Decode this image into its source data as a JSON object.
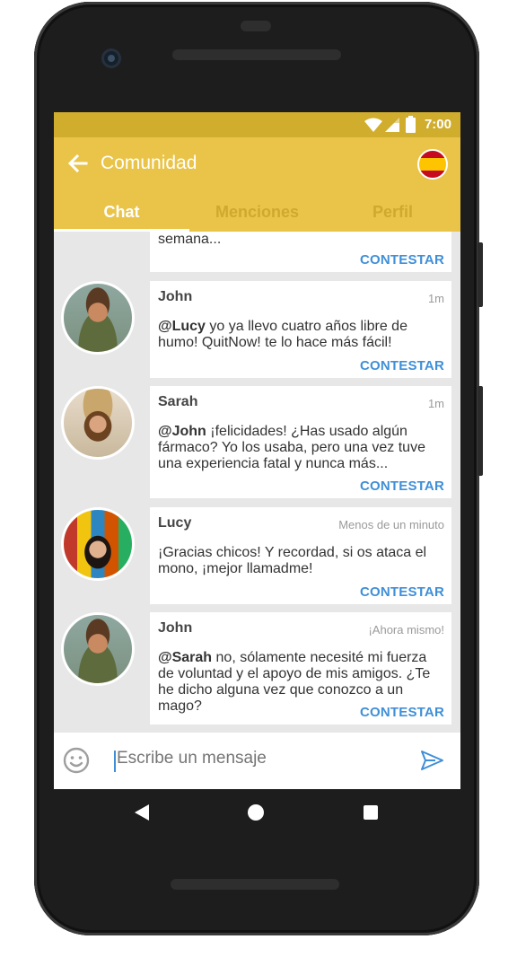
{
  "status_bar": {
    "time": "7:00"
  },
  "app_bar": {
    "title": "Comunidad",
    "back_icon": "arrow-left-icon",
    "language_flag": "spain-flag-icon"
  },
  "tabs": [
    {
      "label": "Chat",
      "active": true
    },
    {
      "label": "Menciones",
      "active": false
    },
    {
      "label": "Perfil",
      "active": false
    }
  ],
  "messages": [
    {
      "text": "semana...",
      "reply": "CONTESTAR"
    },
    {
      "name": "John",
      "time": "1m",
      "mention": "@Lucy",
      "text": " yo ya llevo cuatro años libre de humo! QuitNow! te lo hace más fácil!",
      "reply": "CONTESTAR"
    },
    {
      "name": "Sarah",
      "time": "1m",
      "mention": "@John",
      "text": " ¡felicidades! ¿Has usado algún fármaco? Yo los usaba, pero una vez tuve una experiencia fatal y nunca más...",
      "reply": "CONTESTAR"
    },
    {
      "name": "Lucy",
      "time": "Menos de un minuto",
      "mention": "",
      "text": "¡Gracias chicos! Y recordad, si os ataca el mono, ¡mejor llamadme!",
      "reply": "CONTESTAR"
    },
    {
      "name": "John",
      "time": "¡Ahora mismo!",
      "mention": "@Sarah",
      "text": " no, sólamente necesité mi fuerza de voluntad y el apoyo de mis amigos. ¿Te he dicho alguna vez que conozco a un mago?",
      "reply": "CONTESTAR"
    }
  ],
  "composer": {
    "placeholder": "Escribe un mensaje"
  },
  "colors": {
    "accent": "#e9c448",
    "status_bar": "#d1ad2d",
    "link": "#3f8fd8"
  }
}
